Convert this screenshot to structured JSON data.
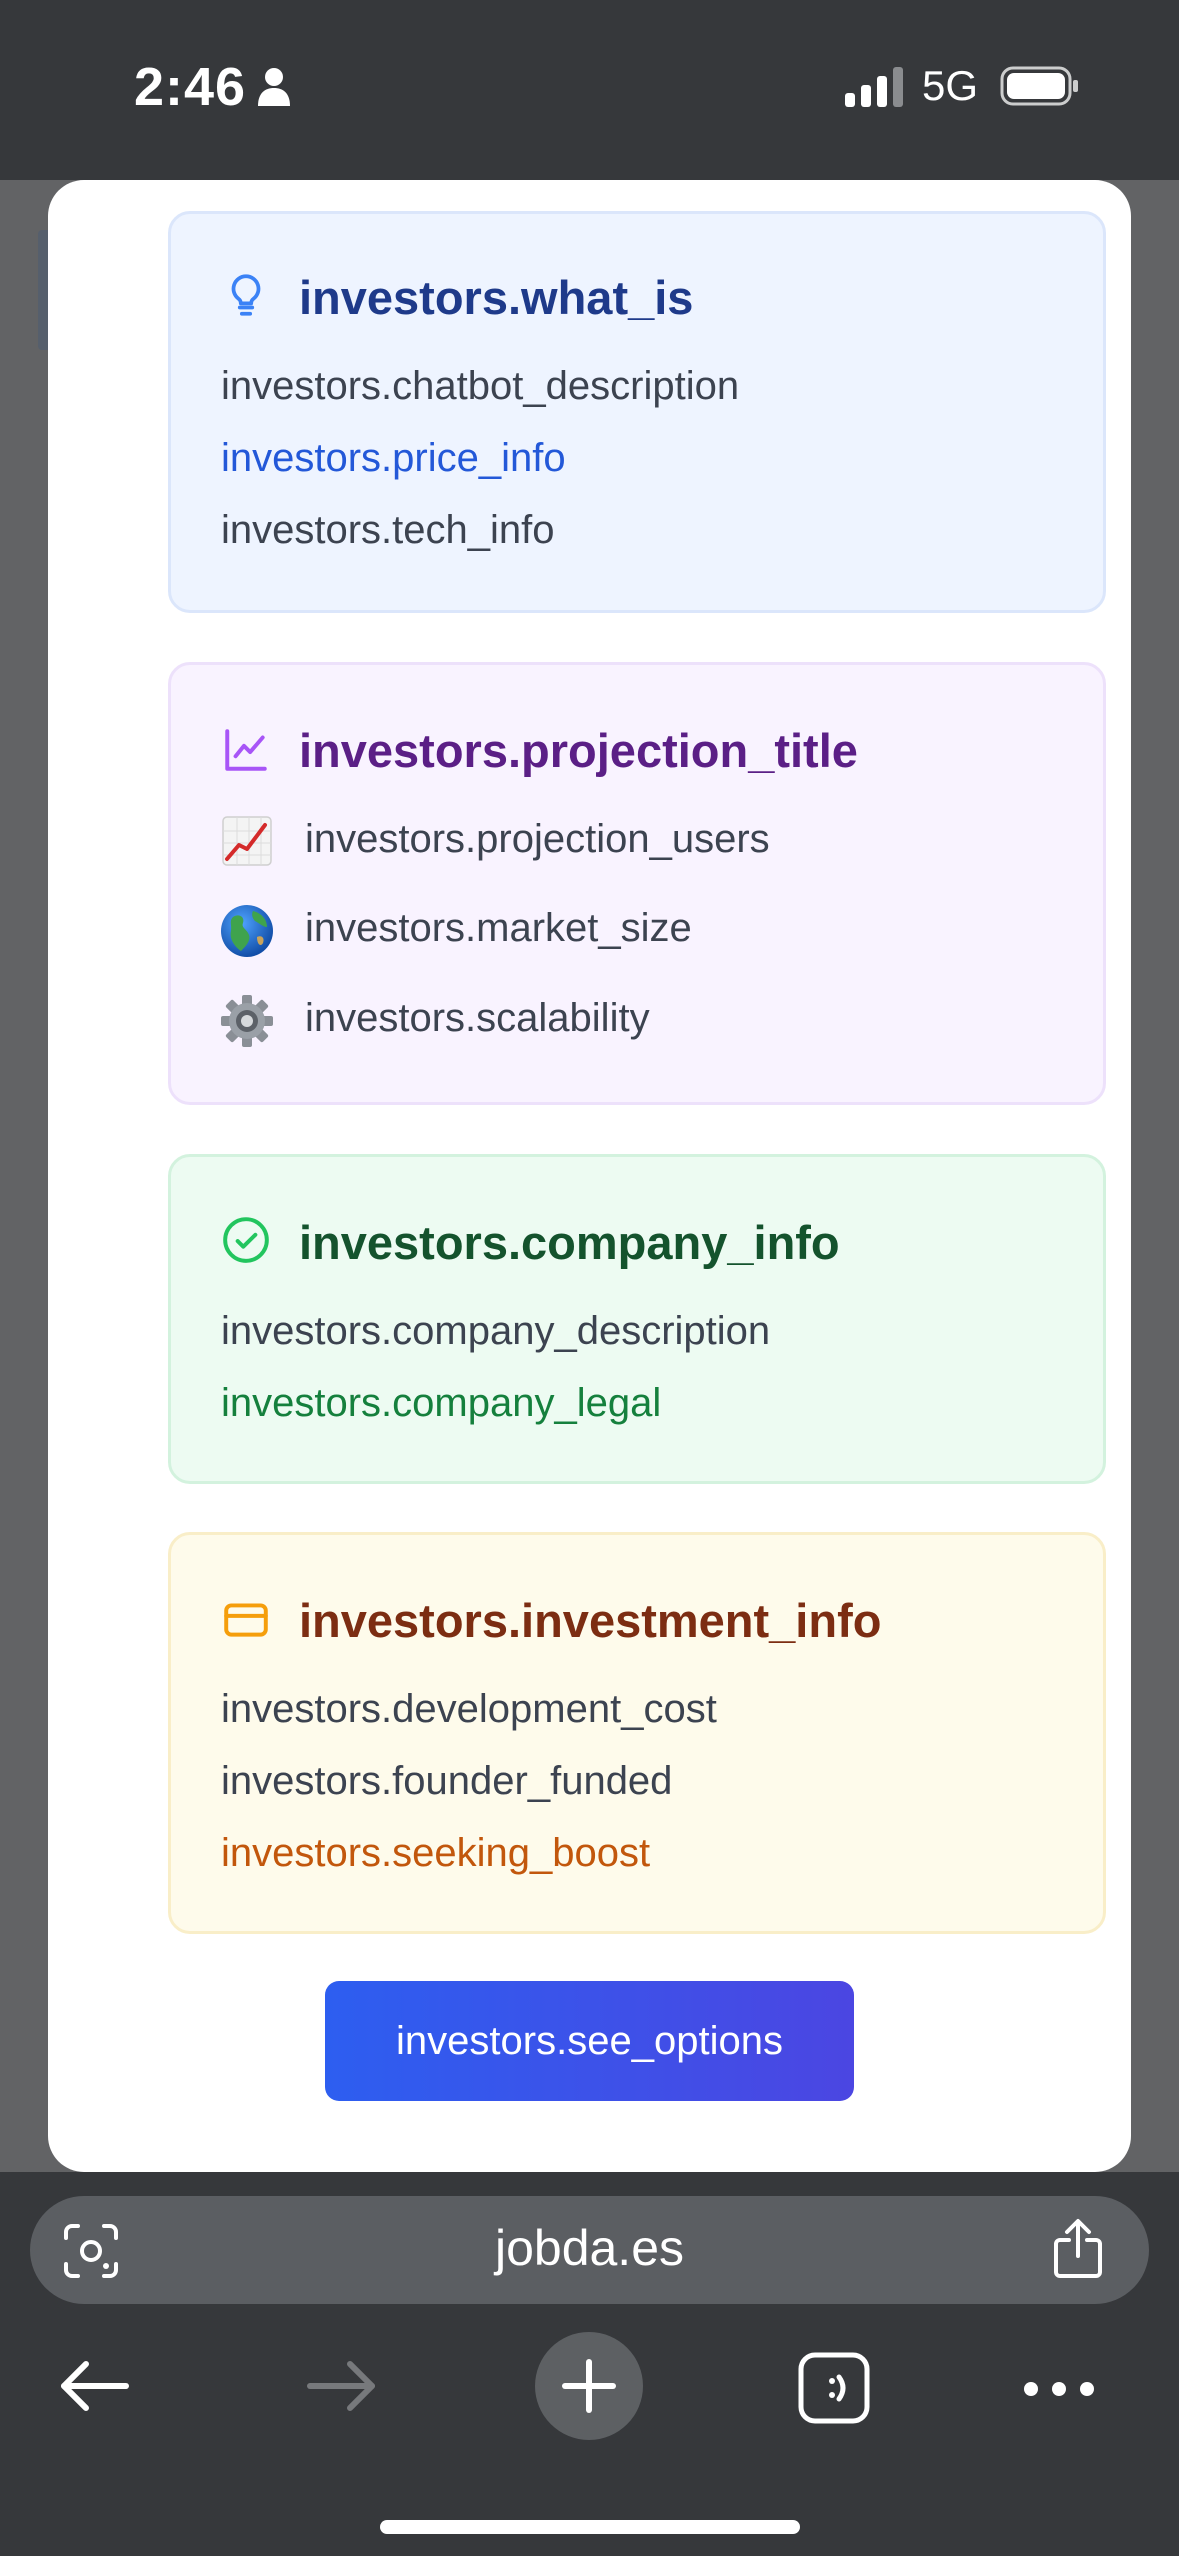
{
  "status_bar": {
    "time": "2:46",
    "network": "5G"
  },
  "cards": {
    "what_is": {
      "title": "investors.what_is",
      "icon": "lightbulb-icon",
      "lines": [
        "investors.chatbot_description",
        "investors.price_info",
        "investors.tech_info"
      ]
    },
    "projection": {
      "title": "investors.projection_title",
      "icon": "chart-line-icon",
      "items": [
        {
          "emoji": "chart-increasing-emoji",
          "text": "investors.projection_users"
        },
        {
          "emoji": "globe-emoji",
          "text": "investors.market_size"
        },
        {
          "emoji": "gear-emoji",
          "text": "investors.scalability"
        }
      ]
    },
    "company": {
      "title": "investors.company_info",
      "icon": "check-circle-icon",
      "lines": [
        "investors.company_description",
        "investors.company_legal"
      ]
    },
    "investment": {
      "title": "investors.investment_info",
      "icon": "credit-card-icon",
      "lines": [
        "investors.development_cost",
        "investors.founder_funded",
        "investors.seeking_boost"
      ]
    }
  },
  "cta": {
    "label": "investors.see_options"
  },
  "browser": {
    "url": "jobda.es"
  },
  "colors": {
    "blue_title": "#1e3a8a",
    "blue_accent": "#2358d8",
    "purple_title": "#5b1f86",
    "purple_icon": "#a855f7",
    "green_title": "#14532d",
    "green_accent": "#15803d",
    "yellow_title": "#7c2d12",
    "yellow_accent": "#c2570c",
    "body_text": "#3c4350"
  }
}
